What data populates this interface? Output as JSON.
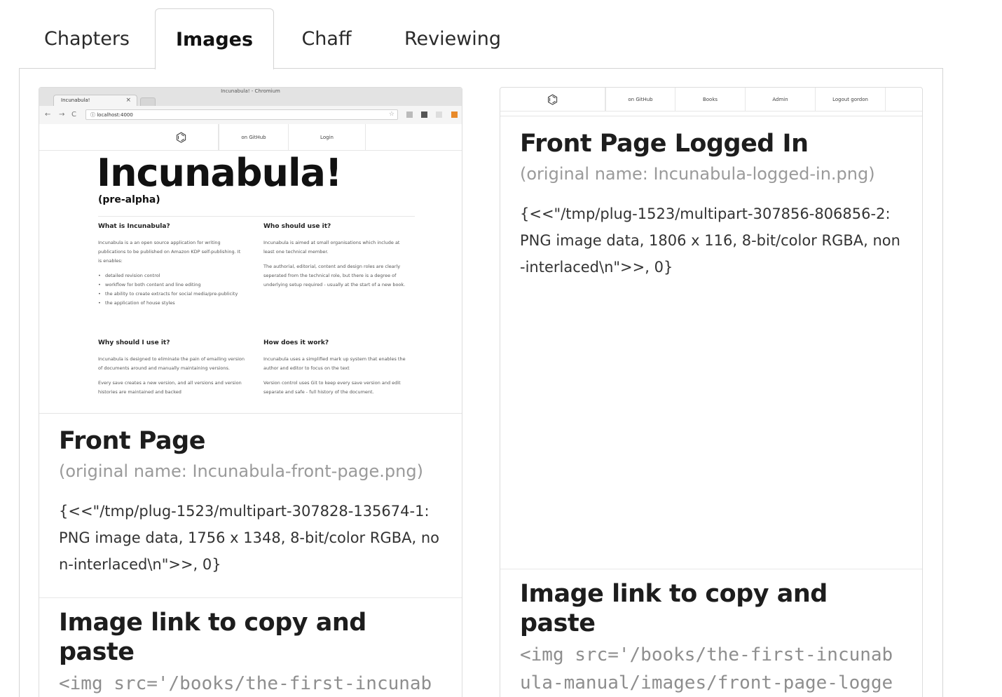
{
  "tabs": [
    {
      "label": "Chapters"
    },
    {
      "label": "Images"
    },
    {
      "label": "Chaff"
    },
    {
      "label": "Reviewing"
    }
  ],
  "active_tab": "Images",
  "cards": [
    {
      "title": "Front Page",
      "original_name": "(original name: Incunabula-front-page.png)",
      "meta": "{<<\"/tmp/plug-1523/multipart-307828-135674-1: PNG image data, 1756 x 1348, 8-bit/color RGBA, non-interlaced\\n\">>, 0}",
      "link_heading": "Image link to copy and paste",
      "link_code": "<img src='/books/the-first-incunabula-manual/images/front-",
      "thumbnail": {
        "window_title": "Incunabula! - Chromium",
        "tab_label": "Incunabula!",
        "url": "localhost:4000",
        "nav": [
          "on GitHub",
          "Login"
        ],
        "hero": "Incunabula!",
        "sub": "(pre-alpha)",
        "sections": [
          {
            "heading": "What is Incunabula?",
            "paras": [
              "Incunabula is a an open source application for writing publications to be published on Amazon KDP self-publishing. It is enables:"
            ],
            "bullets": [
              "detailed revision control",
              "workflow for both content and line editing",
              "the ability to create extracts for social media/pre-publicity",
              "the application of house styles"
            ]
          },
          {
            "heading": "Who should use it?",
            "paras": [
              "Incunabula is aimed at small organisations which include at least one technical member.",
              "The authorial, editorial, content and design roles are clearly seperated from the technical role, but there is a degree of underlying setup required - usually at the start of a new book."
            ],
            "bullets": []
          },
          {
            "heading": "Why should I use it?",
            "paras": [
              "Incunabula is designed to eliminate the pain of emailing version of documents around and manually maintaining versions.",
              "Every save creates a new version, and all versions and version histories are maintained and backed"
            ],
            "bullets": []
          },
          {
            "heading": "How does it work?",
            "paras": [
              "Incunabula uses a simplified mark up system that enables the author and editor to focus on the text",
              "Version control uses Git to keep every save version and edit separate and safe - full history of the document."
            ],
            "bullets": []
          }
        ]
      }
    },
    {
      "title": "Front Page Logged In",
      "original_name": "(original name: Incunabula-logged-in.png)",
      "meta": "{<<\"/tmp/plug-1523/multipart-307856-806856-2: PNG image data, 1806 x 116, 8-bit/color RGBA, non-interlaced\\n\">>, 0}",
      "link_heading": "Image link to copy and paste",
      "link_code": "<img src='/books/the-first-incunabula-manual/images/front-page-logged-in.png' alt='Front",
      "thumbnail": {
        "nav": [
          "on GitHub",
          "Books",
          "Admin",
          "Logout gordon"
        ]
      }
    }
  ]
}
